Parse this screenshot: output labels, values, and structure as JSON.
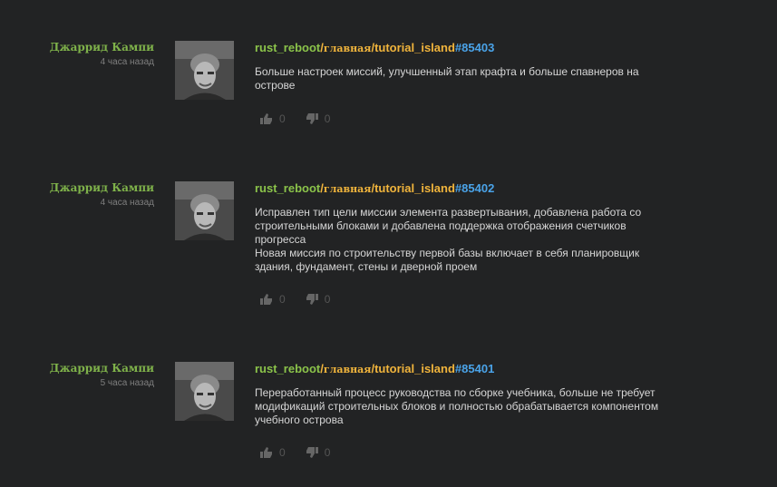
{
  "commits": [
    {
      "author": "Джаррид Кампи",
      "time": "4 часа назад",
      "repo": "rust_reboot",
      "sep1": "/",
      "branch": "главная",
      "sep2": "/",
      "project": "tutorial_island",
      "hash": "#85403",
      "message_lines": [
        "Больше настроек миссий, улучшенный этап крафта и больше спавнеров на",
        "острове"
      ],
      "likes": "0",
      "dislikes": "0"
    },
    {
      "author": "Джаррид Кампи",
      "time": "4 часа назад",
      "repo": "rust_reboot",
      "sep1": "/",
      "branch": "главная",
      "sep2": "/",
      "project": "tutorial_island",
      "hash": "#85402",
      "message_lines": [
        "Исправлен тип цели миссии элемента развертывания, добавлена работа со",
        "строительными блоками и добавлена поддержка отображения счетчиков",
        "прогресса",
        "Новая миссия по строительству первой базы включает в себя планировщик",
        "здания, фундамент, стены и дверной проем"
      ],
      "likes": "0",
      "dislikes": "0"
    },
    {
      "author": "Джаррид Кампи",
      "time": "5 часа назад",
      "repo": "rust_reboot",
      "sep1": "/",
      "branch": "главная",
      "sep2": "/",
      "project": "tutorial_island",
      "hash": "#85401",
      "message_lines": [
        "Переработанный процесс руководства по сборке учебника, больше не требует",
        "модификаций строительных блоков и полностью обрабатывается компонентом",
        "учебного острова"
      ],
      "likes": "0",
      "dislikes": "0"
    }
  ],
  "colors": {
    "background": "#222324",
    "author": "#7fb24a",
    "repo": "#8bc34a",
    "branch": "#f0b43c",
    "hash": "#4aa3e8"
  },
  "icons": {
    "like": "thumbs-up-icon",
    "dislike": "thumbs-down-icon"
  }
}
